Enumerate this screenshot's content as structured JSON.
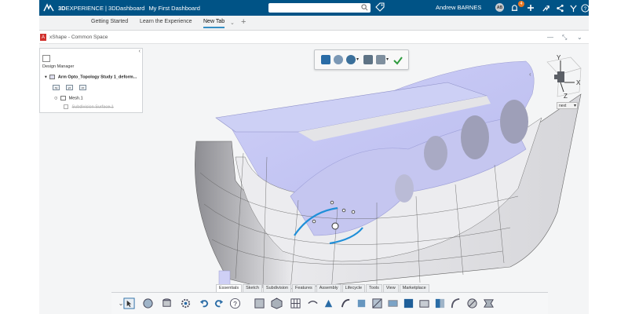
{
  "topbar": {
    "brand_strong": "3D",
    "brand_text": "EXPERIENCE | 3DDashboard",
    "dashboard": "My First Dashboard",
    "user_name": "Andrew BARNES",
    "avatar_initials": "AB",
    "notification_count": "4",
    "bg_color": "#005386"
  },
  "tabs": [
    {
      "label": "Getting Started"
    },
    {
      "label": "Learn the Experience"
    },
    {
      "label": "New Tab"
    }
  ],
  "app": {
    "title": "xShape - Common Space"
  },
  "panel": {
    "header": "Design Manager",
    "study": "Arm Opto_Topology Study 1_deform...",
    "mesh": "Mesh.1",
    "surface": "Subdivision Surface.1"
  },
  "view": {
    "zoom_value": "next"
  },
  "compass_labels": {
    "y": "Y",
    "x": "X",
    "z": "Z"
  },
  "bottom_tabs": [
    {
      "label": "Essentials"
    },
    {
      "label": "Sketch"
    },
    {
      "label": "Subdivision"
    },
    {
      "label": "Features"
    },
    {
      "label": "Assembly"
    },
    {
      "label": "Lifecycle"
    },
    {
      "label": "Tools"
    },
    {
      "label": "View"
    },
    {
      "label": "Marketplace"
    }
  ],
  "colors": {
    "accent": "#368ec4",
    "model_gray": "#e3e3e5",
    "model_purple": "#c9c9f2"
  }
}
